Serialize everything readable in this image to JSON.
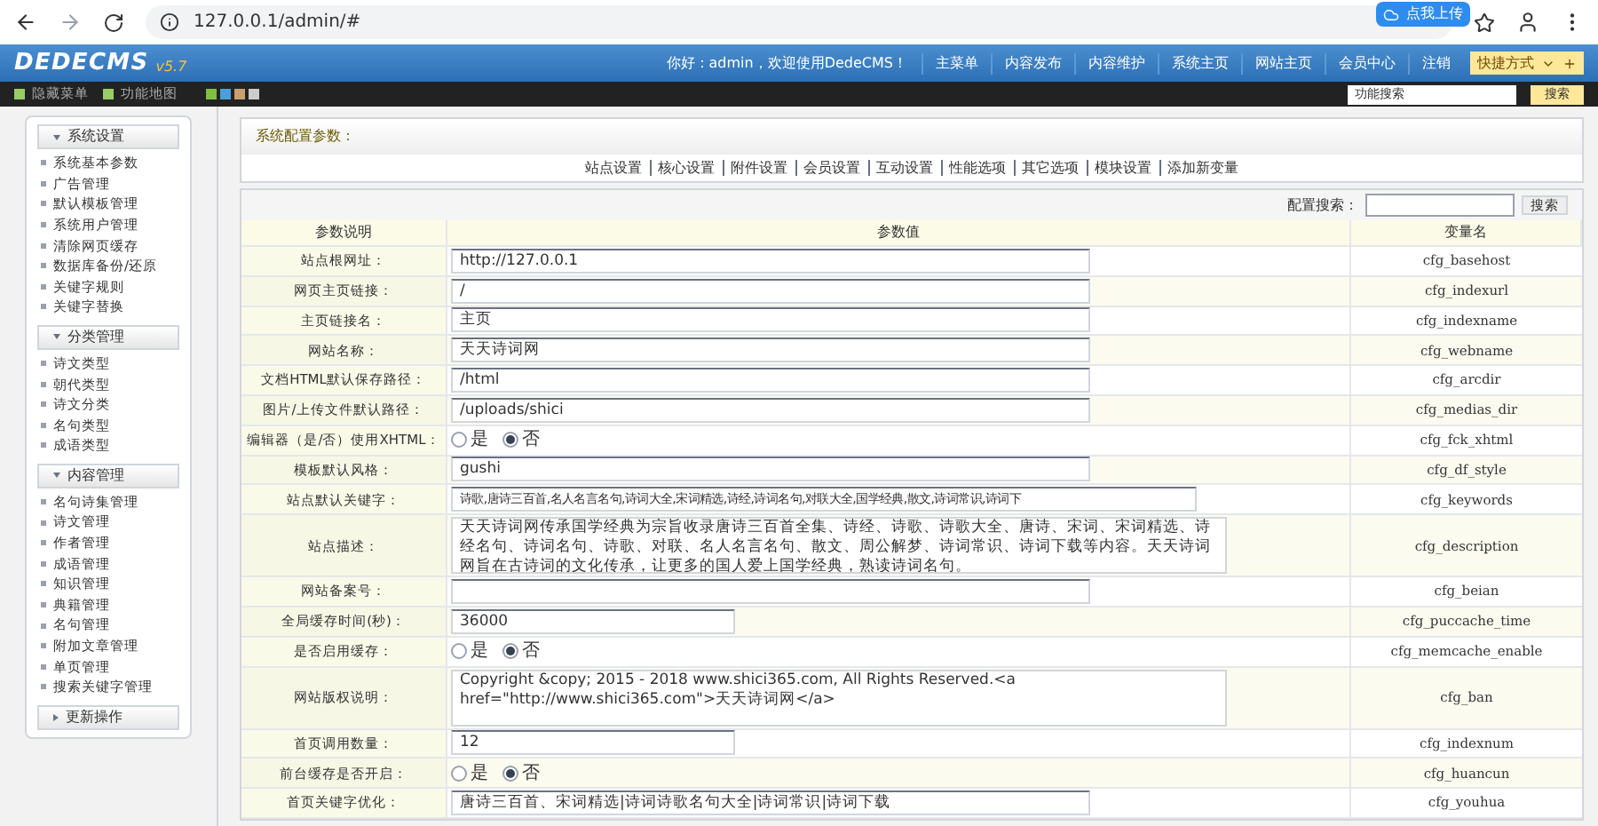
{
  "browser": {
    "url": "127.0.0.1/admin/#",
    "extension_badge": "点我上传"
  },
  "header": {
    "logo": "DEDECMS",
    "version": "v5.7",
    "greeting": "你好：admin，欢迎使用DedeCMS！",
    "nav": [
      "主菜单",
      "内容发布",
      "内容维护",
      "系统主页",
      "网站主页",
      "会员中心",
      "注销"
    ],
    "shortcut": "快捷方式"
  },
  "toolbar": {
    "links": [
      "隐藏菜单",
      "功能地图"
    ],
    "skins": [
      {
        "color": "#7fbf3f"
      },
      {
        "color": "#4a9fd8"
      },
      {
        "color": "#c8a070"
      },
      {
        "color": "#cccccc"
      }
    ],
    "search": {
      "value": "功能搜索"
    },
    "search_button": "搜索"
  },
  "sidebar": [
    {
      "title": "系统设置",
      "expanded": true,
      "items": [
        "系统基本参数",
        "广告管理",
        "默认模板管理",
        "系统用户管理",
        "清除网页缓存",
        "数据库备份/还原",
        "关键字规则",
        "关键字替换"
      ]
    },
    {
      "title": "分类管理",
      "expanded": true,
      "items": [
        "诗文类型",
        "朝代类型",
        "诗文分类",
        "名句类型",
        "成语类型"
      ]
    },
    {
      "title": "内容管理",
      "expanded": true,
      "items": [
        "名句诗集管理",
        "诗文管理",
        "作者管理",
        "成语管理",
        "知识管理",
        "典籍管理",
        "名句管理",
        "附加文章管理",
        "单页管理",
        "搜索关键字管理"
      ]
    },
    {
      "title": "更新操作",
      "expanded": false
    }
  ],
  "panel": {
    "title": "系统配置参数：",
    "tabs": [
      "站点设置",
      "核心设置",
      "附件设置",
      "会员设置",
      "互动设置",
      "性能选项",
      "其它选项",
      "模块设置",
      "添加新变量"
    ],
    "search_label": "配置搜索：",
    "search_button": "搜索"
  },
  "table": {
    "columns": [
      "参数说明",
      "参数值",
      "变量名"
    ],
    "rows": [
      {
        "label": "站点根网址：",
        "kind": "text",
        "value": "http://127.0.0.1",
        "var": "cfg_basehost"
      },
      {
        "label": "网页主页链接：",
        "kind": "text",
        "value": "/",
        "var": "cfg_indexurl"
      },
      {
        "label": "主页链接名：",
        "kind": "text",
        "value": "主页",
        "var": "cfg_indexname"
      },
      {
        "label": "网站名称：",
        "kind": "text",
        "value": "天天诗词网",
        "var": "cfg_webname"
      },
      {
        "label": "文档HTML默认保存路径：",
        "kind": "text",
        "value": "/html",
        "var": "cfg_arcdir"
      },
      {
        "label": "图片/上传文件默认路径：",
        "kind": "text",
        "value": "/uploads/shici",
        "var": "cfg_medias_dir"
      },
      {
        "label": "编辑器（是/否）使用XHTML：",
        "kind": "radio",
        "options": [
          {
            "label": "是",
            "selected": false
          },
          {
            "label": "否",
            "selected": true
          }
        ],
        "var": "cfg_fck_xhtml"
      },
      {
        "label": "模板默认风格：",
        "kind": "text",
        "value": "gushi",
        "var": "cfg_df_style"
      },
      {
        "label": "站点默认关键字：",
        "kind": "wide",
        "value": "诗歌,唐诗三百首,名人名言名句,诗词大全,宋词精选,诗经,诗词名句,对联大全,国学经典,散文,诗词常识,诗词下",
        "var": "cfg_keywords"
      },
      {
        "label": "站点描述：",
        "kind": "textarea",
        "value": "天天诗词网传承国学经典为宗旨收录唐诗三百首全集、诗经、诗歌、诗歌大全、唐诗、宋词、宋词精选、诗经名句、诗词名句、诗歌、对联、名人名言名句、散文、周公解梦、诗词常识、诗词下载等内容。天天诗词网旨在古诗词的文化传承，让更多的国人爱上国学经典，熟读诗词名句。",
        "var": "cfg_description"
      },
      {
        "label": "网站备案号：",
        "kind": "text",
        "value": "",
        "var": "cfg_beian"
      },
      {
        "label": "全局缓存时间(秒)：",
        "kind": "short",
        "value": "36000",
        "var": "cfg_puccache_time"
      },
      {
        "label": "是否启用缓存：",
        "kind": "radio",
        "options": [
          {
            "label": "是",
            "selected": false
          },
          {
            "label": "否",
            "selected": true
          }
        ],
        "var": "cfg_memcache_enable"
      },
      {
        "label": "网站版权说明：",
        "kind": "textarea",
        "value": "Copyright &copy; 2015 - 2018 www.shici365.com, All Rights Reserved.<a href=\"http://www.shici365.com\">天天诗词网</a>",
        "var": "cfg_ban"
      },
      {
        "label": "首页调用数量：",
        "kind": "short",
        "value": "12",
        "var": "cfg_indexnum"
      },
      {
        "label": "前台缓存是否开启：",
        "kind": "radio",
        "options": [
          {
            "label": "是",
            "selected": false
          },
          {
            "label": "否",
            "selected": true
          }
        ],
        "var": "cfg_huancun"
      },
      {
        "label": "首页关键字优化：",
        "kind": "text",
        "value": "唐诗三百首、宋词精选|诗词诗歌名句大全|诗词常识|诗词下载",
        "var": "cfg_youhua"
      }
    ]
  }
}
